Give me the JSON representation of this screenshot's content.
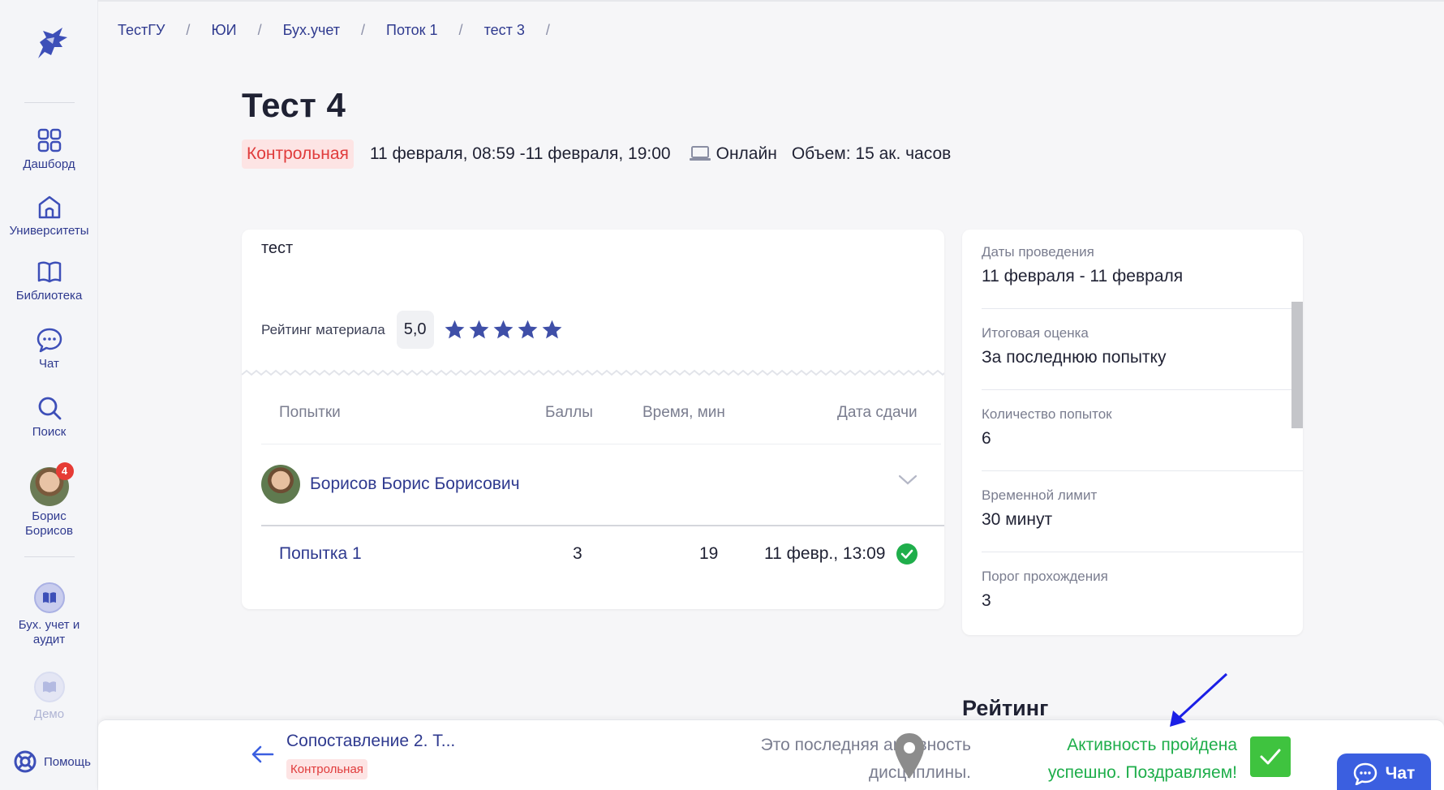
{
  "sidebar": {
    "items": [
      {
        "label": "Дашборд",
        "icon": "grid-icon"
      },
      {
        "label": "Университеты",
        "icon": "university-icon"
      },
      {
        "label": "Библиотека",
        "icon": "book-icon"
      },
      {
        "label": "Чат",
        "icon": "chat-icon"
      },
      {
        "label": "Поиск",
        "icon": "search-icon"
      }
    ],
    "user": {
      "name_line1": "Борис",
      "name_line2": "Борисов",
      "badge": "4"
    },
    "courses": [
      {
        "label_line1": "Бух. учет и",
        "label_line2": "аудит"
      },
      {
        "label_line1": "Демо",
        "label_line2": ""
      }
    ],
    "help_label": "Помощь"
  },
  "breadcrumbs": [
    "ТестГУ",
    "ЮИ",
    "Бух.учет",
    "Поток 1",
    "тест 3"
  ],
  "breadcrumb_sep": "/",
  "page": {
    "title": "Тест 4",
    "type_tag": "Контрольная",
    "dates": "11 февраля, 08:59 -11 февраля, 19:00",
    "format": "Онлайн",
    "volume": "Объем: 15 ак. часов"
  },
  "card": {
    "description": "тест",
    "rating_label": "Рейтинг материала",
    "rating_value": "5,0",
    "stars": 5,
    "table_headers": {
      "attempts": "Попытки",
      "score": "Баллы",
      "time": "Время, мин",
      "date": "Дата сдачи"
    },
    "student_name": "Борисов Борис Борисович",
    "attempts": [
      {
        "name": "Попытка 1",
        "score": "3",
        "time": "19",
        "date": "11 февр., 13:09",
        "passed": true
      }
    ]
  },
  "info": [
    {
      "key": "Даты проведения",
      "value": "11 февраля - 11 февраля"
    },
    {
      "key": "Итоговая оценка",
      "value": "За последнюю попытку"
    },
    {
      "key": "Количество попыток",
      "value": "6"
    },
    {
      "key": "Временной лимит",
      "value": "30 минут"
    },
    {
      "key": "Порог прохождения",
      "value": "3"
    }
  ],
  "rating_heading": "Рейтинг",
  "bottom": {
    "prev_title": "Сопоставление 2. Т...",
    "prev_tag": "Контрольная",
    "last_line1": "Это последняя активность",
    "last_line2": "дисциплины.",
    "done_line1": "Активность пройдена",
    "done_line2": "успешно. Поздравляем!",
    "chat_label": "Чат"
  },
  "colors": {
    "accent": "#2f3a8f",
    "success": "#1fae4b",
    "danger": "#e03b3b",
    "chat": "#3b5fe0",
    "star": "#3f4fa8"
  }
}
